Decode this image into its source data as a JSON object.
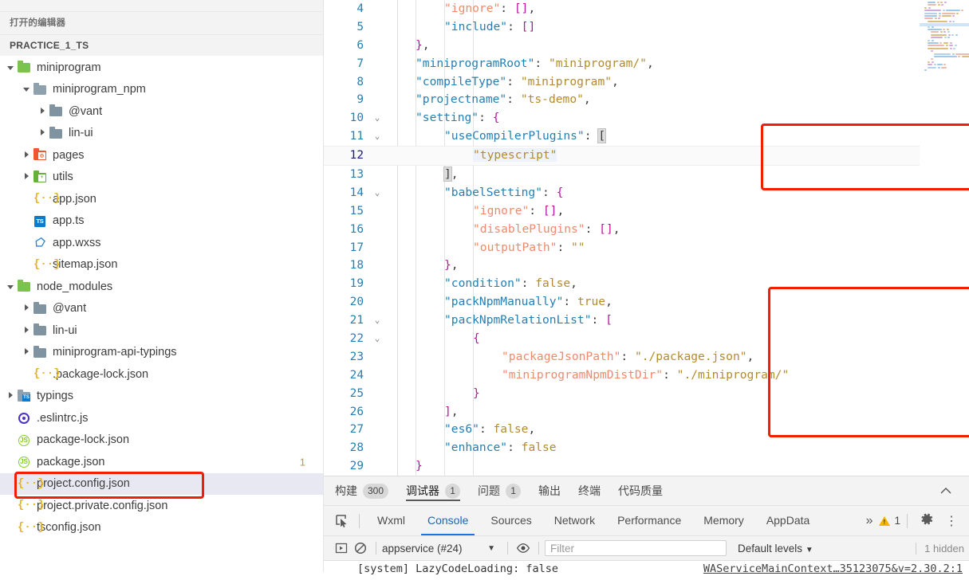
{
  "sidebar": {
    "open_editors_label": "打开的编辑器",
    "project_label": "PRACTICE_1_TS",
    "tree": [
      {
        "label": "miniprogram",
        "indent": 0,
        "twisty": "open",
        "icon": "folder-green-open",
        "badge": ""
      },
      {
        "label": "miniprogram_npm",
        "indent": 1,
        "twisty": "open",
        "icon": "folder-grey-open",
        "badge": ""
      },
      {
        "label": "@vant",
        "indent": 2,
        "twisty": "closed",
        "icon": "folder-grey",
        "badge": ""
      },
      {
        "label": "lin-ui",
        "indent": 2,
        "twisty": "closed",
        "icon": "folder-grey",
        "badge": ""
      },
      {
        "label": "pages",
        "indent": 1,
        "twisty": "closed",
        "icon": "folder-red",
        "badge": ""
      },
      {
        "label": "utils",
        "indent": 1,
        "twisty": "closed",
        "icon": "folder-green",
        "badge": ""
      },
      {
        "label": "app.json",
        "indent": 1,
        "twisty": "none",
        "icon": "json-icon",
        "badge": ""
      },
      {
        "label": "app.ts",
        "indent": 1,
        "twisty": "none",
        "icon": "typescript-icon",
        "badge": ""
      },
      {
        "label": "app.wxss",
        "indent": 1,
        "twisty": "none",
        "icon": "wxss-icon",
        "badge": ""
      },
      {
        "label": "sitemap.json",
        "indent": 1,
        "twisty": "none",
        "icon": "json-icon",
        "badge": ""
      },
      {
        "label": "node_modules",
        "indent": 0,
        "twisty": "open",
        "icon": "folder-green-open",
        "badge": ""
      },
      {
        "label": "@vant",
        "indent": 1,
        "twisty": "closed",
        "icon": "folder-grey",
        "badge": ""
      },
      {
        "label": "lin-ui",
        "indent": 1,
        "twisty": "closed",
        "icon": "folder-grey",
        "badge": ""
      },
      {
        "label": "miniprogram-api-typings",
        "indent": 1,
        "twisty": "closed",
        "icon": "folder-grey",
        "badge": ""
      },
      {
        "label": ".package-lock.json",
        "indent": 1,
        "twisty": "none",
        "icon": "json-icon",
        "badge": ""
      },
      {
        "label": "typings",
        "indent": 0,
        "twisty": "closed",
        "icon": "folder-ts",
        "badge": ""
      },
      {
        "label": ".eslintrc.js",
        "indent": 0,
        "twisty": "none",
        "icon": "eslint-icon",
        "badge": ""
      },
      {
        "label": "package-lock.json",
        "indent": 0,
        "twisty": "none",
        "icon": "js-icon",
        "badge": ""
      },
      {
        "label": "package.json",
        "indent": 0,
        "twisty": "none",
        "icon": "js-icon",
        "badge": "1"
      },
      {
        "label": "project.config.json",
        "indent": 0,
        "twisty": "none",
        "icon": "json-icon",
        "badge": "",
        "selected": true,
        "annotated": true
      },
      {
        "label": "project.private.config.json",
        "indent": 0,
        "twisty": "none",
        "icon": "json-icon",
        "badge": ""
      },
      {
        "label": "tsconfig.json",
        "indent": 0,
        "twisty": "none",
        "icon": "json-icon",
        "badge": ""
      }
    ]
  },
  "editor": {
    "active_line": 12,
    "lines": [
      {
        "n": 4,
        "fold": "",
        "indent": 2,
        "tokens": [
          [
            "k2",
            "\"ignore\""
          ],
          [
            "c",
            ": "
          ],
          [
            "p",
            "[]"
          ],
          [
            "c",
            ","
          ]
        ]
      },
      {
        "n": 5,
        "fold": "",
        "indent": 2,
        "tokens": [
          [
            "k",
            "\"include\""
          ],
          [
            "c",
            ": "
          ],
          [
            "p",
            "[]"
          ]
        ]
      },
      {
        "n": 6,
        "fold": "",
        "indent": 1,
        "tokens": [
          [
            "p",
            "}"
          ],
          [
            "c",
            ","
          ]
        ]
      },
      {
        "n": 7,
        "fold": "",
        "indent": 1,
        "tokens": [
          [
            "k",
            "\"miniprogramRoot\""
          ],
          [
            "c",
            ": "
          ],
          [
            "s",
            "\"miniprogram/\""
          ],
          [
            "c",
            ","
          ]
        ]
      },
      {
        "n": 8,
        "fold": "",
        "indent": 1,
        "tokens": [
          [
            "k",
            "\"compileType\""
          ],
          [
            "c",
            ": "
          ],
          [
            "s",
            "\"miniprogram\""
          ],
          [
            "c",
            ","
          ]
        ]
      },
      {
        "n": 9,
        "fold": "",
        "indent": 1,
        "tokens": [
          [
            "k",
            "\"projectname\""
          ],
          [
            "c",
            ": "
          ],
          [
            "s",
            "\"ts-demo\""
          ],
          [
            "c",
            ","
          ]
        ]
      },
      {
        "n": 10,
        "fold": "v",
        "indent": 1,
        "tokens": [
          [
            "k",
            "\"setting\""
          ],
          [
            "c",
            ": "
          ],
          [
            "p",
            "{"
          ]
        ]
      },
      {
        "n": 11,
        "fold": "v",
        "indent": 2,
        "tokens": [
          [
            "k",
            "\"useCompilerPlugins\""
          ],
          [
            "c",
            ": "
          ],
          [
            "bmatch",
            "["
          ]
        ]
      },
      {
        "n": 12,
        "fold": "",
        "indent": 3,
        "tokens": [
          [
            "s sel",
            "\"typescript\""
          ]
        ]
      },
      {
        "n": 13,
        "fold": "",
        "indent": 2,
        "tokens": [
          [
            "bmatch",
            "]"
          ],
          [
            "c",
            ","
          ]
        ]
      },
      {
        "n": 14,
        "fold": "v",
        "indent": 2,
        "tokens": [
          [
            "k",
            "\"babelSetting\""
          ],
          [
            "c",
            ": "
          ],
          [
            "p",
            "{"
          ]
        ]
      },
      {
        "n": 15,
        "fold": "",
        "indent": 3,
        "tokens": [
          [
            "k2",
            "\"ignore\""
          ],
          [
            "c",
            ": "
          ],
          [
            "p",
            "[]"
          ],
          [
            "c",
            ","
          ]
        ]
      },
      {
        "n": 16,
        "fold": "",
        "indent": 3,
        "tokens": [
          [
            "k2",
            "\"disablePlugins\""
          ],
          [
            "c",
            ": "
          ],
          [
            "p",
            "[]"
          ],
          [
            "c",
            ","
          ]
        ]
      },
      {
        "n": 17,
        "fold": "",
        "indent": 3,
        "tokens": [
          [
            "k2",
            "\"outputPath\""
          ],
          [
            "c",
            ": "
          ],
          [
            "s",
            "\"\""
          ]
        ]
      },
      {
        "n": 18,
        "fold": "",
        "indent": 2,
        "tokens": [
          [
            "p",
            "}"
          ],
          [
            "c",
            ","
          ]
        ]
      },
      {
        "n": 19,
        "fold": "",
        "indent": 2,
        "tokens": [
          [
            "k",
            "\"condition\""
          ],
          [
            "c",
            ": "
          ],
          [
            "s",
            "false"
          ],
          [
            "c",
            ","
          ]
        ]
      },
      {
        "n": 20,
        "fold": "",
        "indent": 2,
        "tokens": [
          [
            "k",
            "\"packNpmManually\""
          ],
          [
            "c",
            ": "
          ],
          [
            "s",
            "true"
          ],
          [
            "c",
            ","
          ]
        ]
      },
      {
        "n": 21,
        "fold": "v",
        "indent": 2,
        "tokens": [
          [
            "k",
            "\"packNpmRelationList\""
          ],
          [
            "c",
            ": "
          ],
          [
            "p",
            "["
          ]
        ]
      },
      {
        "n": 22,
        "fold": "v",
        "indent": 3,
        "tokens": [
          [
            "p",
            "{"
          ]
        ]
      },
      {
        "n": 23,
        "fold": "",
        "indent": 4,
        "tokens": [
          [
            "k2",
            "\"packageJsonPath\""
          ],
          [
            "c",
            ": "
          ],
          [
            "s",
            "\"./package.json\""
          ],
          [
            "c",
            ","
          ]
        ]
      },
      {
        "n": 24,
        "fold": "",
        "indent": 4,
        "tokens": [
          [
            "k2",
            "\"miniprogramNpmDistDir\""
          ],
          [
            "c",
            ": "
          ],
          [
            "s",
            "\"./miniprogram/\""
          ]
        ]
      },
      {
        "n": 25,
        "fold": "",
        "indent": 3,
        "tokens": [
          [
            "p",
            "}"
          ]
        ]
      },
      {
        "n": 26,
        "fold": "",
        "indent": 2,
        "tokens": [
          [
            "p",
            "]"
          ],
          [
            "c",
            ","
          ]
        ]
      },
      {
        "n": 27,
        "fold": "",
        "indent": 2,
        "tokens": [
          [
            "k",
            "\"es6\""
          ],
          [
            "c",
            ": "
          ],
          [
            "s",
            "false"
          ],
          [
            "c",
            ","
          ]
        ]
      },
      {
        "n": 28,
        "fold": "",
        "indent": 2,
        "tokens": [
          [
            "k",
            "\"enhance\""
          ],
          [
            "c",
            ": "
          ],
          [
            "s",
            "false"
          ]
        ]
      },
      {
        "n": 29,
        "fold": "",
        "indent": 1,
        "tokens": [
          [
            "p",
            "}"
          ]
        ]
      }
    ]
  },
  "panel": {
    "tabs": [
      {
        "label": "构建",
        "count": "300",
        "active": false
      },
      {
        "label": "调试器",
        "count": "1",
        "active": true
      },
      {
        "label": "问题",
        "count": "1",
        "active": false
      },
      {
        "label": "输出",
        "count": "",
        "active": false
      },
      {
        "label": "终端",
        "count": "",
        "active": false
      },
      {
        "label": "代码质量",
        "count": "",
        "active": false
      }
    ],
    "collapse_icon": "chevron-up-icon",
    "devtools_tabs": [
      {
        "label": "Wxml",
        "active": false
      },
      {
        "label": "Console",
        "active": true
      },
      {
        "label": "Sources",
        "active": false
      },
      {
        "label": "Network",
        "active": false
      },
      {
        "label": "Performance",
        "active": false
      },
      {
        "label": "Memory",
        "active": false
      },
      {
        "label": "AppData",
        "active": false
      }
    ],
    "more_tabs_icon": "chevron-double-right-icon",
    "warning_count": "1",
    "settings_icon": "gear-icon",
    "menu_icon": "kebab-menu-icon",
    "console": {
      "execute_icon": "execution-context-icon",
      "clear_icon": "clear-console-icon",
      "context_value": "appservice (#24)",
      "eye_icon": "live-expression-icon",
      "filter_placeholder": "Filter",
      "levels_label": "Default levels",
      "hidden_label": "1 hidden",
      "message": "[system] LazyCodeLoading: false",
      "source": "WAServiceMainContext…35123075&v=2.30.2:1"
    }
  },
  "colors": {
    "annotation_red": "#f01f00",
    "selection_blue": "#e8e8f2",
    "accent_blue": "#1a73e8"
  }
}
